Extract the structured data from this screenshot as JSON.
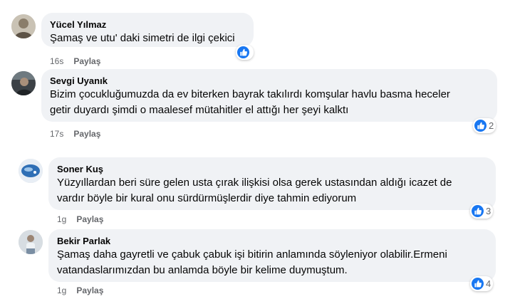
{
  "comments": [
    {
      "author": "Yücel Yılmaz",
      "lines": [
        "Şamaş ve utu' daki simetri de ilgi çekici"
      ],
      "time": "16s",
      "reply": "Paylaş",
      "like_count": ""
    },
    {
      "author": "Sevgi Uyanık",
      "lines": [
        "Bizim çocukluğumuzda da ev biterken bayrak takılırdı komşular havlu basma heceler",
        "getir duyardı şimdi o maalesef mütahitler el attığı her şeyi kalktı"
      ],
      "time": "17s",
      "reply": "Paylaş",
      "like_count": "2"
    },
    {
      "author": "Soner Kuş",
      "lines": [
        "Yüzyıllardan beri süre gelen usta çırak ilişkisi olsa gerek ustasından aldığı icazet de",
        "vardır böyle bir kural onu sürdürmüşlerdir diye tahmin ediyorum"
      ],
      "time": "1g",
      "reply": "Paylaş",
      "like_count": "3"
    },
    {
      "author": "Bekir Parlak",
      "lines": [
        "Şamaş daha gayretli ve çabuk çabuk işi bitirin anlamında söyleniyor olabilir.Ermeni",
        "vatandaslarımızdan bu anlamda böyle bir kelime duymuştum."
      ],
      "time": "1g",
      "reply": "Paylaş",
      "like_count": "4"
    }
  ],
  "colors": {
    "bubble_bg": "#f0f2f5",
    "meta_text": "#65676b",
    "like_blue": "#1877f2"
  },
  "icons": {
    "like": "thumbs-up-icon"
  }
}
